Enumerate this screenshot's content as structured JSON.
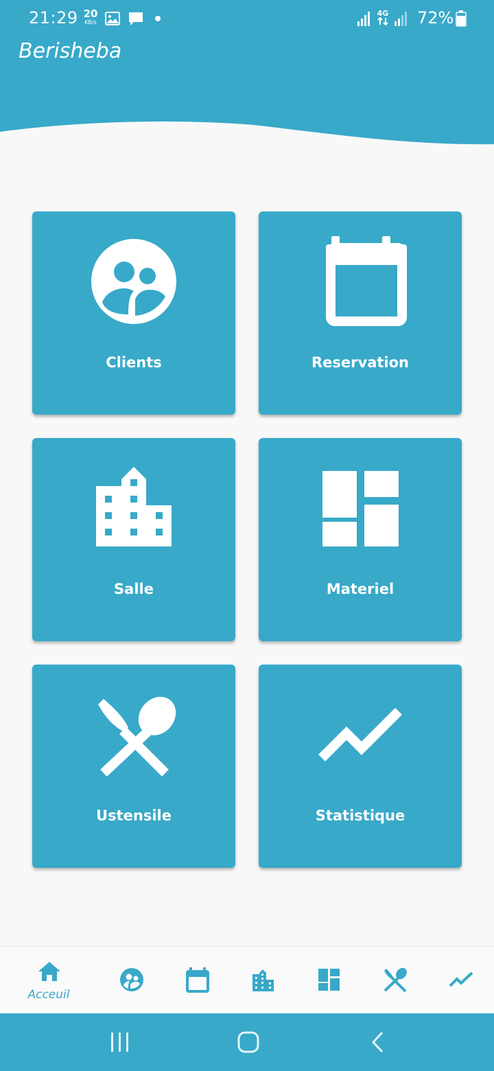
{
  "colors": {
    "primary": "#38a9c9",
    "background": "#f8f8f8",
    "tile_text": "#ffffff",
    "nav_bar": "#fafafa"
  },
  "status_bar": {
    "time": "21:29",
    "net_speed_value": "20",
    "net_speed_unit": "KB/s",
    "network_type": "4G",
    "battery": "72%",
    "icons": [
      "image-icon",
      "message-icon",
      "dot-icon",
      "signal-icon",
      "lte-icon",
      "signal-icon",
      "battery-icon"
    ]
  },
  "app": {
    "title": "Berisheba"
  },
  "tiles": [
    {
      "label": "Clients",
      "icon": "clients-icon"
    },
    {
      "label": "Reservation",
      "icon": "calendar-icon"
    },
    {
      "label": "Salle",
      "icon": "building-icon"
    },
    {
      "label": "Materiel",
      "icon": "dashboard-icon"
    },
    {
      "label": "Ustensile",
      "icon": "utensils-icon"
    },
    {
      "label": "Statistique",
      "icon": "trending-icon"
    }
  ],
  "bottom_nav": {
    "items": [
      {
        "label": "Acceuil",
        "icon": "home-icon",
        "active": true
      },
      {
        "label": "",
        "icon": "clients-icon"
      },
      {
        "label": "",
        "icon": "calendar-icon"
      },
      {
        "label": "",
        "icon": "building-icon"
      },
      {
        "label": "",
        "icon": "dashboard-icon"
      },
      {
        "label": "",
        "icon": "utensils-icon"
      },
      {
        "label": "",
        "icon": "trending-icon"
      }
    ]
  },
  "system_nav": {
    "buttons": [
      "recents-icon",
      "home-button-icon",
      "back-icon"
    ]
  }
}
